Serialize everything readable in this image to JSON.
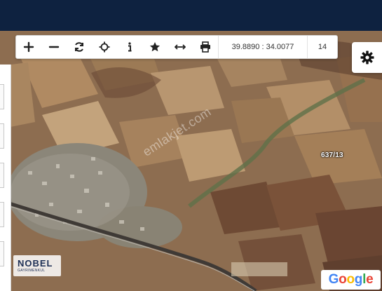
{
  "toolbar": {
    "buttons": [
      {
        "name": "zoom-in-button",
        "icon": "plus-icon"
      },
      {
        "name": "zoom-out-button",
        "icon": "minus-icon"
      },
      {
        "name": "refresh-button",
        "icon": "refresh-icon"
      },
      {
        "name": "locate-button",
        "icon": "crosshair-icon"
      },
      {
        "name": "info-button",
        "icon": "info-icon"
      },
      {
        "name": "favorite-button",
        "icon": "star-icon"
      },
      {
        "name": "measure-button",
        "icon": "horizontal-arrows-icon"
      },
      {
        "name": "print-button",
        "icon": "printer-icon"
      }
    ],
    "coordinates": "39.8890 : 34.0077",
    "zoom_level": "14"
  },
  "settings": {
    "icon": "gear-icon"
  },
  "map": {
    "type": "satellite",
    "parcel_label": "637/13",
    "watermark": "emlakjet.com",
    "logo": {
      "main": "NOBEL",
      "sub": "GAYRIMENKUL"
    },
    "attribution": {
      "letters": [
        "G",
        "o",
        "o",
        "g",
        "l",
        "e"
      ],
      "colors": [
        "#4285f4",
        "#ea4335",
        "#fbbc05",
        "#4285f4",
        "#34a853",
        "#ea4335"
      ]
    }
  },
  "colors": {
    "topbar": "#0e2240",
    "toolbar_bg": "#ffffff",
    "icon": "#222222"
  }
}
